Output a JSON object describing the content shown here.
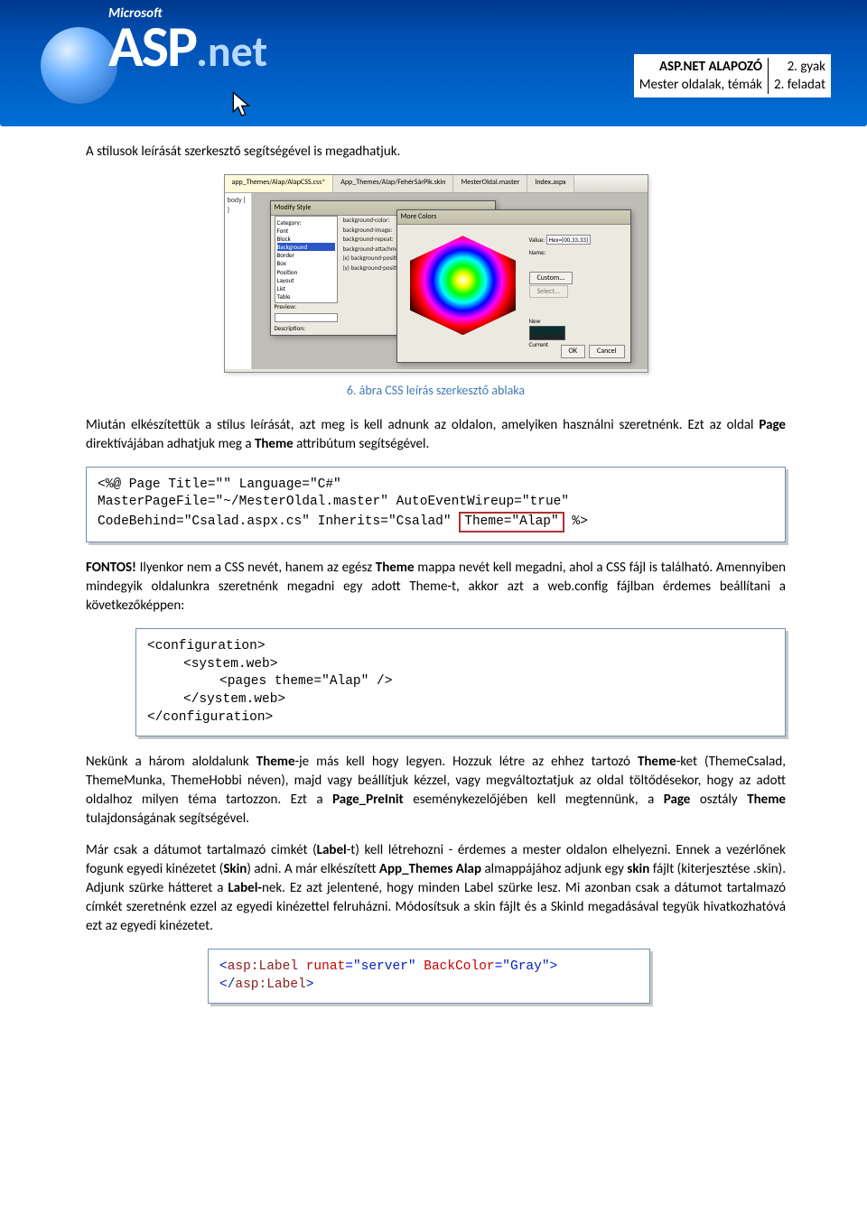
{
  "header": {
    "microsoft": "Microsoft",
    "asp": "ASP",
    "net": ".net",
    "title_row1_left": "ASP.NET ALAPOZÓ",
    "title_row1_right": "2. gyak",
    "title_row2_left": "Mester oldalak, témák",
    "title_row2_right": "2. feladat"
  },
  "p1": "A stílusok leírását szerkesztő segítségével is megadhatjuk.",
  "caption1": "6. ábra CSS leírás szerkesztő ablaka",
  "p2_a": "Miután elkészítettük a stílus leírását, azt meg is kell adnunk az oldalon, amelyiken használni szeretnénk. Ezt az oldal ",
  "p2_b": "Page",
  "p2_c": " direktívájában adhatjuk meg a ",
  "p2_d": "Theme",
  "p2_e": " attribútum segítségével.",
  "code1_l1": "<%@ Page Title=\"\" Language=\"C#\"",
  "code1_l2": "MasterPageFile=\"~/MesterOldal.master\" AutoEventWireup=\"true\"",
  "code1_l3a": "CodeBehind=\"Csalad.aspx.cs\" Inherits=\"Csalad\" ",
  "code1_hl": "Theme=\"Alap\"",
  "code1_l3b": " %>",
  "p3_a": "FONTOS!",
  "p3_b": " Ilyenkor nem a CSS nevét, hanem az egész ",
  "p3_c": "Theme",
  "p3_d": " mappa nevét kell megadni, ahol a CSS fájl is található. Amennyiben mindegyik oldalunkra szeretnénk megadni egy adott Theme-t, akkor azt a web.config fájlban érdemes beállítani a következőképpen:",
  "code2": {
    "l1": "<configuration>",
    "l2": "<system.web>",
    "l3": "<pages theme=\"Alap\" />",
    "l4": "</system.web>",
    "l5": "</configuration>"
  },
  "p4_a": "Nekünk a három aloldalunk ",
  "p4_b": "Theme",
  "p4_c": "-je más kell hogy legyen. Hozzuk létre az ehhez tartozó ",
  "p4_d": "Theme",
  "p4_e": "-ket (ThemeCsalad, ThemeMunka, ThemeHobbi néven), majd vagy beállítjuk kézzel, vagy megváltoztatjuk az oldal töltődésekor, hogy az adott oldalhoz milyen téma tartozzon. Ezt a ",
  "p4_f": "Page_PreInit",
  "p4_g": " eseménykezelőjében kell megtennünk, a ",
  "p4_h": "Page",
  "p4_i": " osztály ",
  "p4_j": "Theme",
  "p4_k": " tulajdonságának segítségével.",
  "p5_a": "Már csak a dátumot tartalmazó cimkét (",
  "p5_b": "Label",
  "p5_c": "-t) kell létrehozni  - érdemes a mester oldalon elhelyezni.  Ennek a vezérlőnek fogunk egyedi kinézetet (",
  "p5_d": "Skin",
  "p5_e": ") adni. A már elkészített ",
  "p5_f": "App_Themes Alap",
  "p5_g": " almappájához adjunk egy ",
  "p5_h": "skin",
  "p5_i": " fájlt (kiterjesztése .skin).  Adjunk szürke hátteret a ",
  "p5_j": "Label-",
  "p5_k": "nek. Ez azt jelentené, hogy minden Label szürke lesz. Mi azonban csak a dátumot tartalmazó címkét szeretnénk ezzel az egyedi kinézettel felruházni. Módosítsuk a skin fájlt és a SkinId megadásával tegyük hivatkozhatóvá ezt az egyedi kinézetet.",
  "code3": {
    "open_lt": "<",
    "tag": "asp:Label",
    "sp1": " ",
    "attr1": "runat",
    "eq": "=\"server\"",
    "sp2": " ",
    "attr2": "BackColor",
    "eq2": "=\"Gray\"",
    "close_gt": ">",
    "close_open": "</",
    "close_tag": "asp:Label",
    "close_end": ">"
  },
  "screenshot": {
    "tabs": [
      "app_Themes/Alap/AlapCSS.css*",
      "App_Themes/Alap/FehérSárPlk.skin",
      "MesterOldal.master",
      "Index.aspx"
    ],
    "left_text": "body\n{\n}",
    "dialog1_title": "Modify Style",
    "listitems": [
      "Category:",
      "Font",
      "Block",
      "Background",
      "Border",
      "Box",
      "Position",
      "Layout",
      "List",
      "Table"
    ],
    "props": [
      "background-color:",
      "background-image:",
      "background-repeat:",
      "background-attachment:",
      "(x) background-position:",
      "(y) background-position:"
    ],
    "preview_label": "Preview:",
    "desc_label": "Description:",
    "dialog2_title": "More Colors",
    "value_label": "Value:",
    "value_val": "Hex={00,33,33}",
    "name_label": "Name:",
    "custom_btn": "Custom...",
    "select_btn": "Select...",
    "new_label": "New",
    "current_label": "Current",
    "ok": "OK",
    "cancel": "Cancel"
  }
}
